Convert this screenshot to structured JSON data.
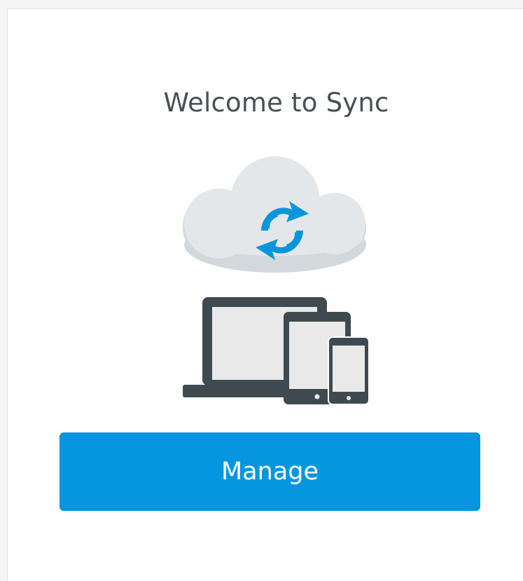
{
  "welcome": {
    "title": "Welcome to Sync"
  },
  "illustration": {
    "icons": [
      "cloud-icon",
      "sync-arrows-icon",
      "laptop-icon",
      "tablet-icon",
      "phone-icon"
    ],
    "colors": {
      "cloud": "#e4e7ea",
      "cloud_shadow": "#d3d8dc",
      "sync_arrows": "#0b96db",
      "device_frame": "#3e4a50",
      "device_screen": "#e9e9e9"
    }
  },
  "actions": {
    "manage_label": "Manage",
    "accent": "#0696e0"
  }
}
